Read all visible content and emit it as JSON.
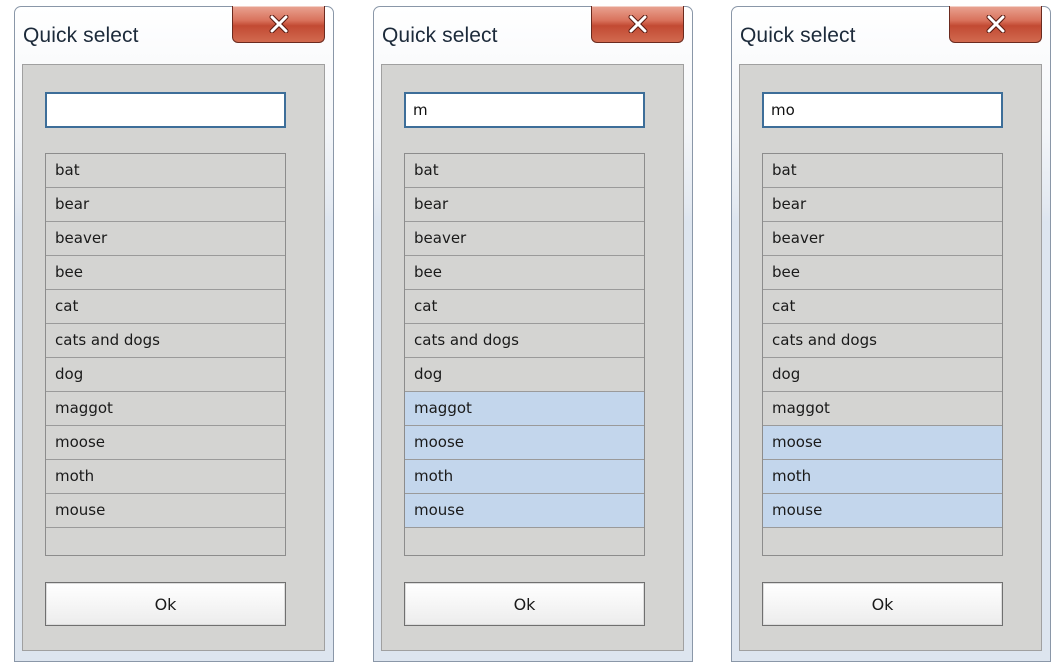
{
  "dialogs": [
    {
      "title": "Quick select",
      "search": {
        "value": "",
        "caret": true
      },
      "items": [
        {
          "label": "bat",
          "highlighted": false
        },
        {
          "label": "bear",
          "highlighted": false
        },
        {
          "label": "beaver",
          "highlighted": false
        },
        {
          "label": "bee",
          "highlighted": false
        },
        {
          "label": "cat",
          "highlighted": false
        },
        {
          "label": "cats and dogs",
          "highlighted": false
        },
        {
          "label": "dog",
          "highlighted": false
        },
        {
          "label": "maggot",
          "highlighted": false
        },
        {
          "label": "moose",
          "highlighted": false
        },
        {
          "label": "moth",
          "highlighted": false
        },
        {
          "label": "mouse",
          "highlighted": false
        }
      ],
      "ok_label": "Ok"
    },
    {
      "title": "Quick select",
      "search": {
        "value": "m",
        "caret": false
      },
      "items": [
        {
          "label": "bat",
          "highlighted": false
        },
        {
          "label": "bear",
          "highlighted": false
        },
        {
          "label": "beaver",
          "highlighted": false
        },
        {
          "label": "bee",
          "highlighted": false
        },
        {
          "label": "cat",
          "highlighted": false
        },
        {
          "label": "cats and dogs",
          "highlighted": false
        },
        {
          "label": "dog",
          "highlighted": false
        },
        {
          "label": "maggot",
          "highlighted": true
        },
        {
          "label": "moose",
          "highlighted": true
        },
        {
          "label": "moth",
          "highlighted": true
        },
        {
          "label": "mouse",
          "highlighted": true
        }
      ],
      "ok_label": "Ok"
    },
    {
      "title": "Quick select",
      "search": {
        "value": "mo",
        "caret": true
      },
      "items": [
        {
          "label": "bat",
          "highlighted": false
        },
        {
          "label": "bear",
          "highlighted": false
        },
        {
          "label": "beaver",
          "highlighted": false
        },
        {
          "label": "bee",
          "highlighted": false
        },
        {
          "label": "cat",
          "highlighted": false
        },
        {
          "label": "cats and dogs",
          "highlighted": false
        },
        {
          "label": "dog",
          "highlighted": false
        },
        {
          "label": "maggot",
          "highlighted": false
        },
        {
          "label": "moose",
          "highlighted": true
        },
        {
          "label": "moth",
          "highlighted": true
        },
        {
          "label": "mouse",
          "highlighted": true
        }
      ],
      "ok_label": "Ok"
    }
  ],
  "icons": {
    "close": "close-x-icon"
  },
  "colors": {
    "highlight": "#c3d6ec",
    "panel": "#d4d4d2",
    "search_border": "#3d6e99",
    "close_button": "#c24a33"
  }
}
